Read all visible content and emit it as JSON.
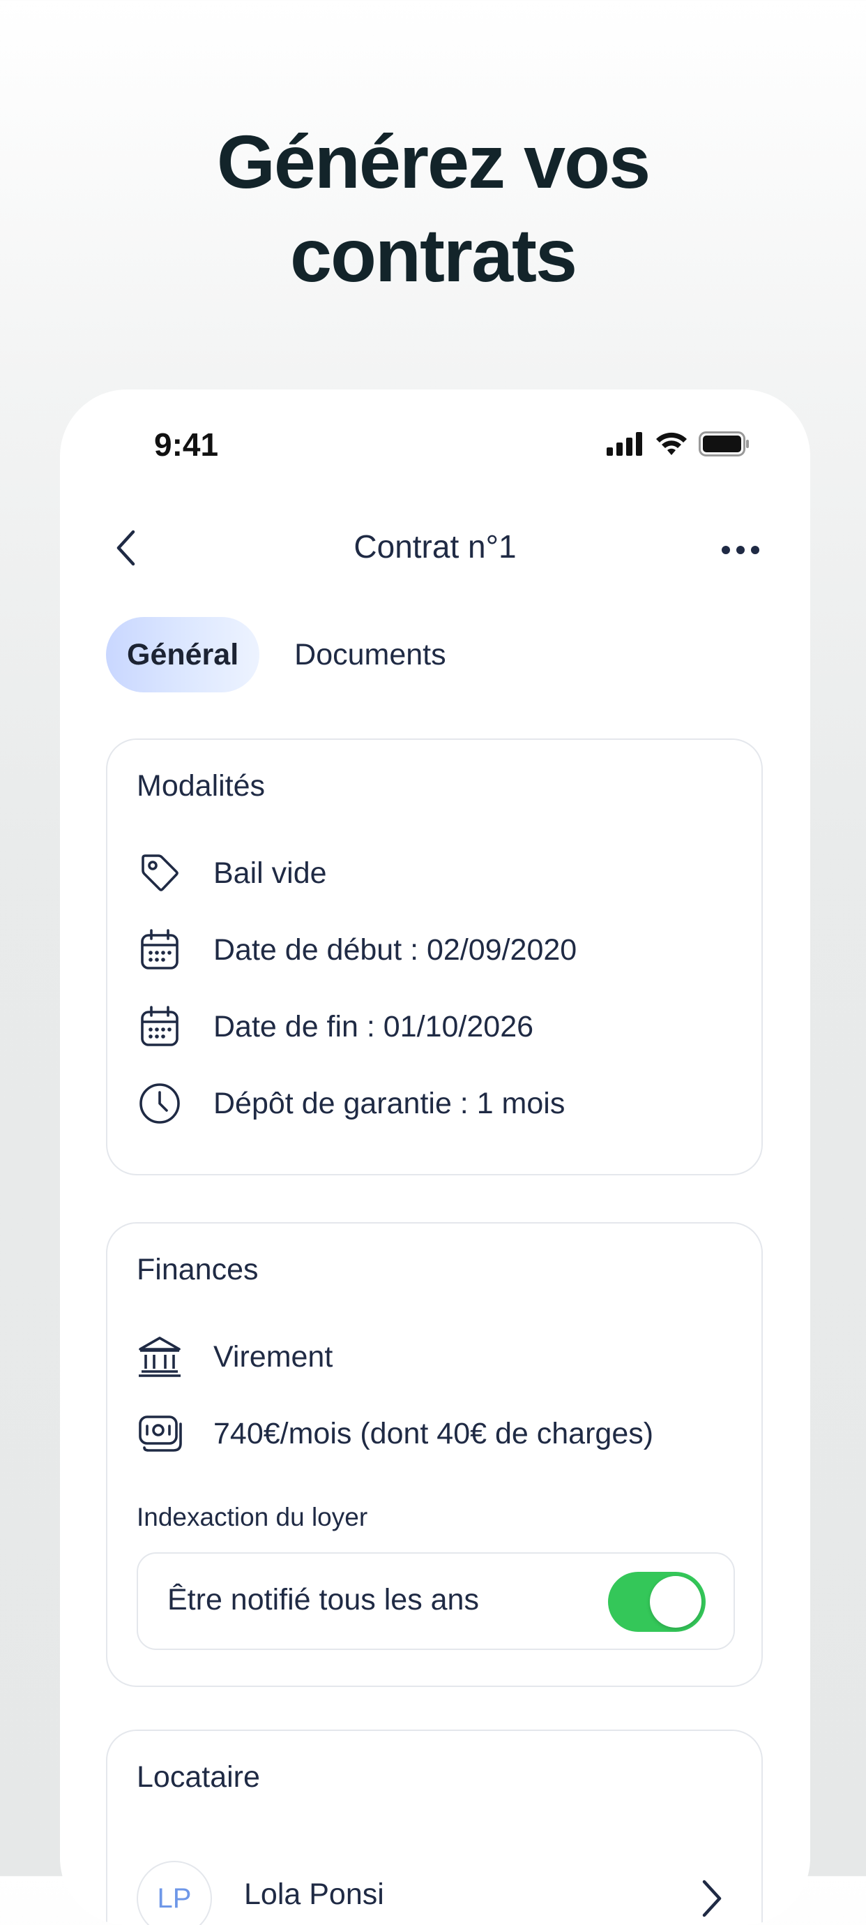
{
  "headline": {
    "line1": "Générez vos",
    "line2": "contrats"
  },
  "status_bar": {
    "time": "9:41"
  },
  "nav": {
    "title": "Contrat n°1"
  },
  "tabs": [
    {
      "label": "Général",
      "active": true
    },
    {
      "label": "Documents",
      "active": false
    }
  ],
  "modalites": {
    "title": "Modalités",
    "items": [
      {
        "icon": "tag-icon",
        "text": "Bail vide"
      },
      {
        "icon": "calendar-icon",
        "text": "Date de début : 02/09/2020"
      },
      {
        "icon": "calendar-icon",
        "text": "Date de fin : 01/10/2026"
      },
      {
        "icon": "clock-icon",
        "text": "Dépôt de garantie : 1 mois"
      }
    ]
  },
  "finances": {
    "title": "Finances",
    "items": [
      {
        "icon": "bank-icon",
        "text": "Virement"
      },
      {
        "icon": "money-icon",
        "text": "740€/mois (dont 40€ de charges)"
      }
    ],
    "indexation_label": "Indexaction du loyer",
    "toggle_label": "Être notifié tous les ans",
    "toggle_on": true
  },
  "locataire": {
    "title": "Locataire",
    "initials": "LP",
    "name": "Lola Ponsi"
  },
  "colors": {
    "accent_green": "#34c759",
    "tab_gradient_start": "#c9d7ff",
    "text_dark": "#1f2a44",
    "headline": "#13242a"
  }
}
